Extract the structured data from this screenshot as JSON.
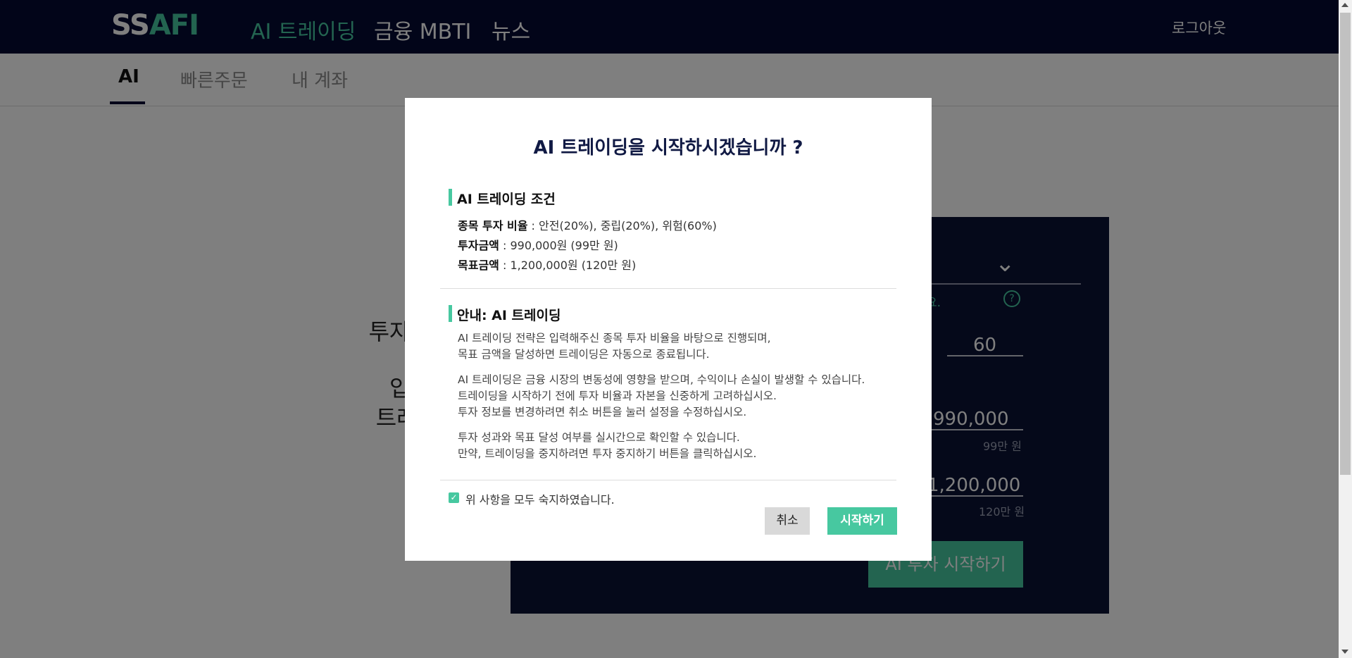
{
  "header": {
    "logo_part1": "SS",
    "logo_part2": "AFI",
    "nav": [
      {
        "label": "AI 트레이딩",
        "active": true
      },
      {
        "label": "금융 MBTI",
        "active": false
      },
      {
        "label": "뉴스",
        "active": false
      }
    ],
    "logout": "로그아웃"
  },
  "subnav": {
    "tabs": [
      {
        "label": "AI",
        "active": true
      },
      {
        "label": "빠른주문",
        "active": false
      },
      {
        "label": "내 계좌",
        "active": false
      }
    ]
  },
  "background": {
    "intro_lines": [
      "투자 전략을 알려",
      "",
      "입력한 값을 바",
      "트레이딩이 진행"
    ],
    "hint_fragment": "요.",
    "ratio_value": "60",
    "investment_value": "990,000",
    "investment_sub": "99만 원",
    "target_value": "1,200,000",
    "target_sub": "120만 원",
    "start_button": "AI 투자 시작하기"
  },
  "modal": {
    "title": "AI 트레이딩을 시작하시겠습니까 ?",
    "conditions": {
      "title": "AI 트레이딩 조건",
      "ratio_label": "종목 투자 비율",
      "ratio_value": " : 안전(20%), 중립(20%), 위험(60%)",
      "amount_label": "투자금액",
      "amount_value": " : 990,000원 (99만 원)",
      "target_label": "목표금액",
      "target_value": " : 1,200,000원 (120만 원)"
    },
    "guide": {
      "title": "안내: AI 트레이딩",
      "para1": [
        "AI 트레이딩 전략은 입력해주신 종목 투자 비율을 바탕으로 진행되며,",
        "목표 금액을 달성하면 트레이딩은 자동으로 종료됩니다."
      ],
      "para2": [
        "AI 트레이딩은 금융 시장의 변동성에 영향을 받으며, 수익이나 손실이 발생할 수 있습니다.",
        "트레이딩을 시작하기 전에 투자 비율과 자본을 신중하게 고려하십시오.",
        "투자 정보를 변경하려면 취소 버튼을 눌러 설정을 수정하십시오."
      ],
      "para3": [
        "투자 성과와 목표 달성 여부를 실시간으로 확인할 수 있습니다.",
        "만약, 트레이딩을 중지하려면 투자 중지하기 버튼을 클릭하십시오."
      ]
    },
    "agree_label": "위 사항을 모두 숙지하였습니다.",
    "agree_checked": true,
    "cancel_button": "취소",
    "start_button": "시작하기"
  },
  "colors": {
    "navy": "#040b33",
    "accent": "#47c8a0"
  }
}
